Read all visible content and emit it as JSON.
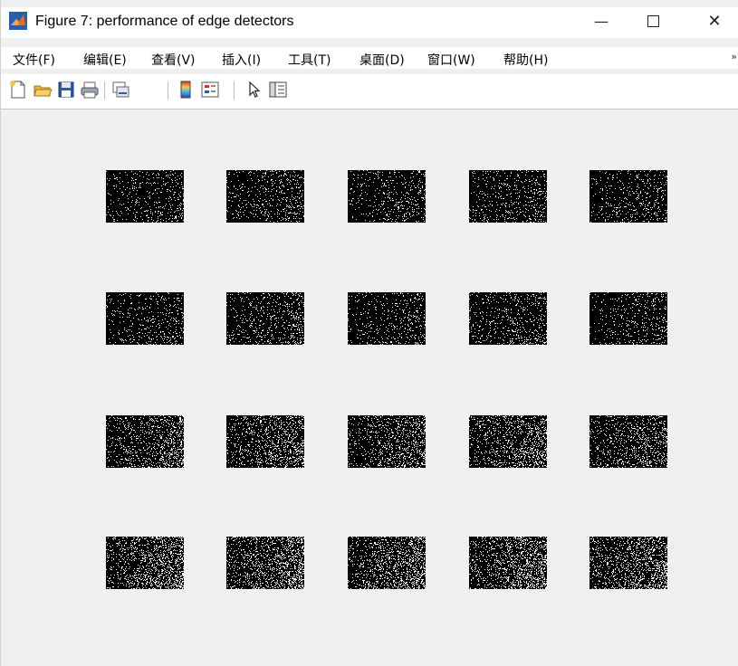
{
  "window": {
    "title": "Figure 7: performance of edge detectors",
    "minimize_glyph": "—",
    "close_glyph": "✕"
  },
  "menubar": {
    "items": [
      {
        "label": "文件(F)"
      },
      {
        "label": "编辑(E)"
      },
      {
        "label": "查看(V)"
      },
      {
        "label": "插入(I)"
      },
      {
        "label": "工具(T)"
      },
      {
        "label": "桌面(D)"
      },
      {
        "label": "窗口(W)"
      },
      {
        "label": "帮助(H)"
      }
    ],
    "overflow_glyph": "»"
  },
  "toolbar": {
    "icons": [
      "new-figure-icon",
      "open-file-icon",
      "save-icon",
      "print-icon",
      "link-plot-icon",
      "colorbar-icon",
      "legend-icon",
      "pointer-icon",
      "plot-browser-icon"
    ]
  },
  "figure": {
    "rows": 4,
    "cols": 5,
    "subplot_background": "#000000",
    "edge_color": "#ffffff",
    "density_by_row": [
      0.1,
      0.11,
      0.2,
      0.26
    ]
  },
  "colors": {
    "window_bg": "#f0f0f0",
    "titlebar_bg": "#ffffff",
    "matlab_orange": "#e86c1f",
    "matlab_blue": "#2a5fa8"
  }
}
